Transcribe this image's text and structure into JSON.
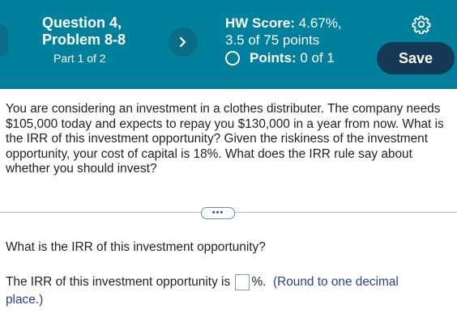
{
  "header": {
    "question_title": "Question 4,",
    "problem_title": "Problem 8-8",
    "part": "Part 1 of 2",
    "hw_score_label": "HW Score:",
    "hw_score_value": "4.67%,",
    "points_earned": "3.5 of 75 points",
    "points_label": "Points:",
    "points_value": "0 of 1",
    "save_label": "Save",
    "next_icon": "chevron-right-icon",
    "settings_icon": "gear-icon",
    "status_icon": "circle-outline-icon"
  },
  "question": {
    "text": "You are considering an investment in a clothes distributer. The company needs $105,000 today and expects to repay you $130,000 in a year from now.  What is the IRR of this investment opportunity?  Given the riskiness of the investment opportunity, your cost of capital is 18%. What does the IRR rule say about whether you should invest?",
    "more_label": "•••"
  },
  "part": {
    "prompt": "What is the IRR of this investment opportunity?",
    "answer_prefix": "The IRR of this investment opportunity is",
    "answer_value": "",
    "answer_suffix": "%.",
    "hint": "(Round to one decimal place.)"
  },
  "colors": {
    "header_bg": "#00809d",
    "save_bg": "#163a55",
    "hint_text": "#2a3f8f"
  }
}
